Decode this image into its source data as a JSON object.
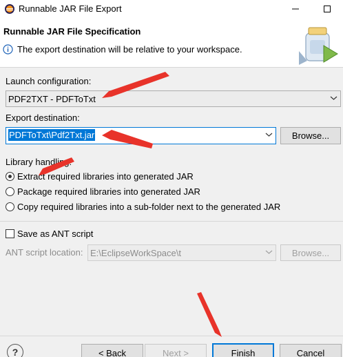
{
  "window": {
    "title": "Runnable JAR File Export",
    "minimize_glyph": "—",
    "maximize_glyph": "☐",
    "app_icon": "eclipse-icon"
  },
  "header": {
    "title": "Runnable JAR File Specification",
    "message": "The export destination will be relative to your workspace.",
    "info_icon": "info-icon",
    "banner_icon": "jar-export-icon"
  },
  "launch": {
    "label": "Launch configuration:",
    "value": "PDF2TXT - PDFToTxt"
  },
  "export": {
    "label": "Export destination:",
    "value": "PDFToTxt\\Pdf2Txt.jar",
    "browse_label": "Browse..."
  },
  "library": {
    "label": "Library handling:",
    "options": [
      {
        "label": "Extract required libraries into generated JAR",
        "selected": true
      },
      {
        "label": "Package required libraries into generated JAR",
        "selected": false
      },
      {
        "label": "Copy required libraries into a sub-folder next to the generated JAR",
        "selected": false
      }
    ]
  },
  "ant": {
    "checkbox_label": "Save as ANT script",
    "checked": false,
    "location_label": "ANT script location:",
    "location_value": "E:\\EclipseWorkSpace\\t",
    "browse_label": "Browse..."
  },
  "footer": {
    "help_glyph": "?",
    "back_label": "< Back",
    "next_label": "Next >",
    "finish_label": "Finish",
    "cancel_label": "Cancel"
  },
  "colors": {
    "accent": "#0078d7",
    "annotation_red": "#e8332a"
  }
}
